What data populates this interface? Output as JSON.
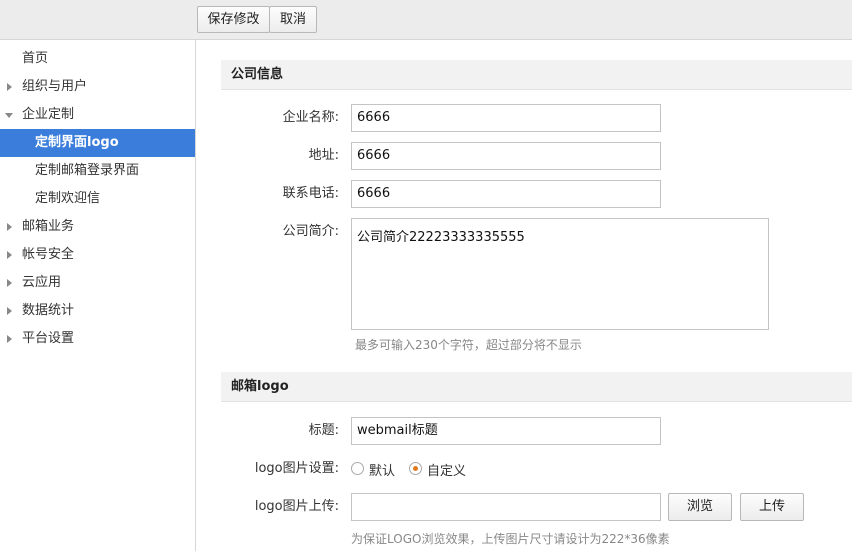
{
  "toolbar": {
    "save_label": "保存修改",
    "cancel_label": "取消"
  },
  "sidebar": {
    "items": [
      {
        "label": "首页"
      },
      {
        "label": "组织与用户"
      },
      {
        "label": "企业定制"
      },
      {
        "label": "定制界面logo"
      },
      {
        "label": "定制邮箱登录界面"
      },
      {
        "label": "定制欢迎信"
      },
      {
        "label": "邮箱业务"
      },
      {
        "label": "帐号安全"
      },
      {
        "label": "云应用"
      },
      {
        "label": "数据统计"
      },
      {
        "label": "平台设置"
      }
    ]
  },
  "company": {
    "section_title": "公司信息",
    "name_label": "企业名称:",
    "name_value": "6666",
    "address_label": "地址:",
    "address_value": "6666",
    "phone_label": "联系电话:",
    "phone_value": "6666",
    "intro_label": "公司简介:",
    "intro_value": "公司简介22223333335555",
    "intro_hint": "最多可输入230个字符，超过部分将不显示"
  },
  "logo": {
    "section_title": "邮箱logo",
    "title_label": "标题:",
    "title_value": "webmail标题",
    "setting_label": "logo图片设置:",
    "option_default": "默认",
    "option_custom": "自定义",
    "selected": "自定义",
    "upload_label": "logo图片上传:",
    "upload_value": "",
    "browse_label": "浏览",
    "upload_button_label": "上传",
    "upload_hint": "为保证LOGO浏览效果，上传图片尺寸请设计为222*36像素"
  },
  "colors": {
    "active_bg": "#3b7ddb",
    "radio_dot": "#e07a1f"
  }
}
